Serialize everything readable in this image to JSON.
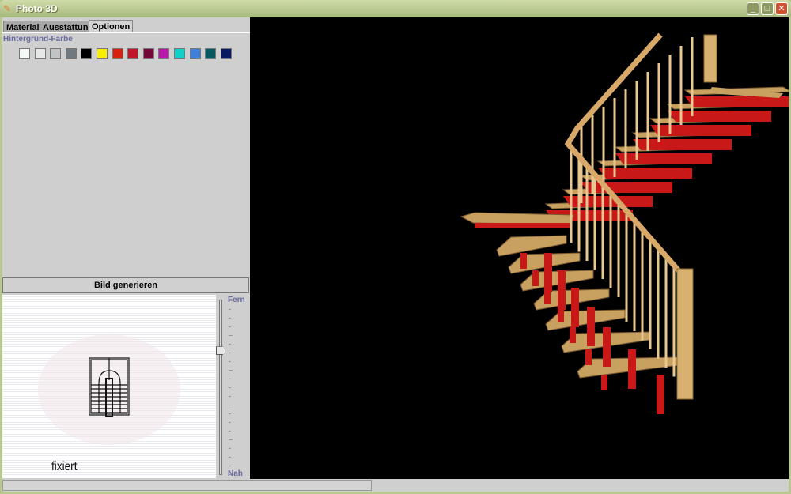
{
  "window": {
    "title": "Photo 3D",
    "controls": [
      "minimize",
      "maximize",
      "close"
    ]
  },
  "tabs": [
    {
      "label": "Material",
      "active": false
    },
    {
      "label": "Ausstattung",
      "active": false
    },
    {
      "label": "Optionen",
      "active": true
    }
  ],
  "options": {
    "background_label": "Hintergrund-Farbe",
    "swatches": [
      "#f4f8f8",
      "#e6e8e8",
      "#c0c4c4",
      "#707880",
      "#000000",
      "#f8f000",
      "#d82010",
      "#c01828",
      "#700838",
      "#b818a8",
      "#10d0c8",
      "#4080d8",
      "#085860",
      "#081860"
    ]
  },
  "generate_button": "Bild generieren",
  "preview": {
    "status_text": "fixiert"
  },
  "distance_slider": {
    "top_label": "Fern",
    "bottom_label": "Nah",
    "value_fraction_from_top": 0.29
  },
  "viewport": {
    "background": "#000000",
    "tread_color": "#c8a060",
    "stringer_color": "#c81818",
    "rail_color": "#e8c890"
  }
}
